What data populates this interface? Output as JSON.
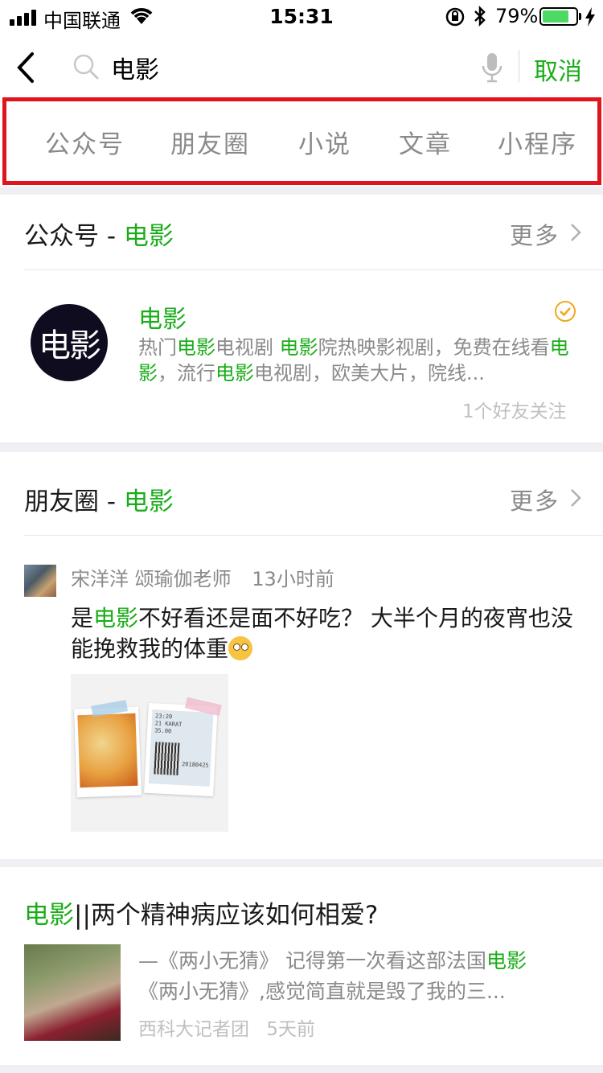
{
  "status_bar": {
    "carrier": "中国联通",
    "time": "15:31",
    "battery_percent": "79%",
    "battery_level": 0.79
  },
  "search": {
    "query": "电影",
    "cancel_label": "取消"
  },
  "tabs": [
    "公众号",
    "朋友圈",
    "小说",
    "文章",
    "小程序"
  ],
  "official_accounts": {
    "title_prefix": "公众号 - ",
    "title_keyword": "电影",
    "more_label": "更多",
    "account": {
      "logo_text": "电影",
      "name": "电影",
      "desc_parts": [
        "热门",
        "电影",
        "电视剧 ",
        "电影",
        "院热映影视剧，免费在线看",
        "电影",
        "，流行",
        "电影",
        "电视剧，欧美大片，院线..."
      ],
      "followers": "1个好友关注"
    }
  },
  "moments": {
    "title_prefix": "朋友圈 - ",
    "title_keyword": "电影",
    "more_label": "更多",
    "post": {
      "author": "宋洋洋 颂瑜伽老师",
      "time_ago": "13小时前",
      "text_before": "是",
      "text_keyword": "电影",
      "text_after": "不好看还是面不好吃？ 大半个月的夜宵也没能挽救我的体重",
      "ticket_lines": [
        "23:20",
        "21 KARAT",
        "35.00",
        "20180425"
      ]
    }
  },
  "article": {
    "title_keyword": "电影",
    "title_rest": "||两个精神病应该如何相爱?",
    "desc_before": "—《两小无猜》 记得第一次看这部法国",
    "desc_keyword": "电影",
    "desc_after": "《两小无猜》,感觉简直就是毁了我的三...",
    "source": "西科大记者团",
    "time_ago": "5天前"
  },
  "colors": {
    "accent_green": "#1aad19",
    "highlight_red": "#e0141e"
  }
}
